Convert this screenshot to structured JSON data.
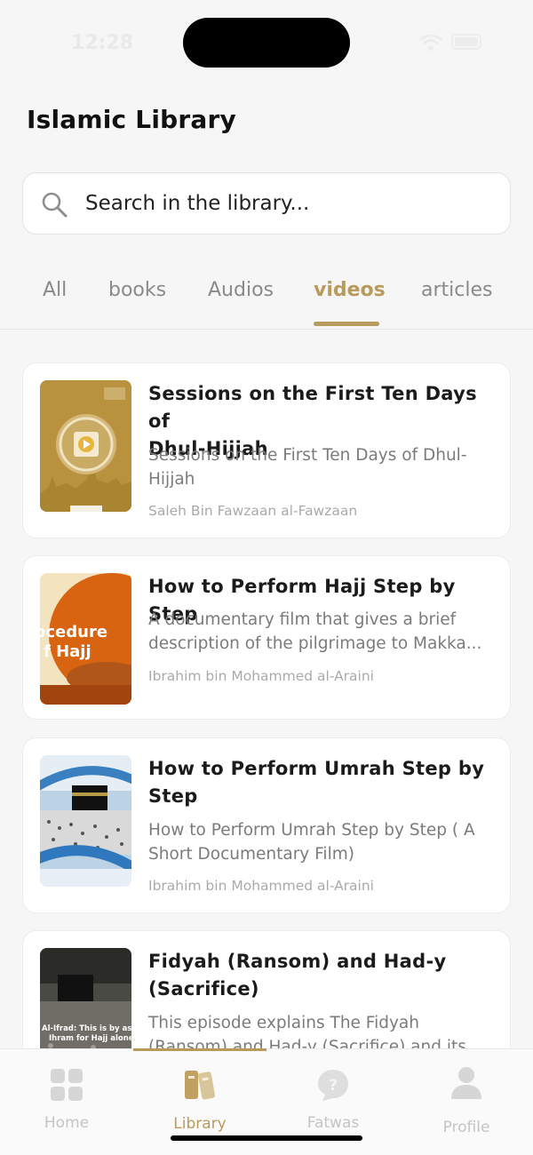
{
  "status": {
    "time": "12:28"
  },
  "header": {
    "title": "Islamic Library"
  },
  "search": {
    "placeholder": "Search in the library..."
  },
  "tabs": [
    {
      "label": "All"
    },
    {
      "label": "books"
    },
    {
      "label": "Audios"
    },
    {
      "label": "videos",
      "active": true
    },
    {
      "label": "articles"
    }
  ],
  "items": [
    {
      "title_line1": "Sessions on the First Ten Days of",
      "title_line2": "Dhul-Hijjah",
      "desc_line1": "Sessions on the First Ten Days of Dhul-",
      "desc_line2": "Hijjah",
      "author": "Saleh Bin Fawzaan al-Fawzaan",
      "thumb_text": "hajjumrah.com"
    },
    {
      "title_line1": "How to Perform Hajj Step by Step",
      "desc_line1": "A documentary film that gives a brief",
      "desc_line2": "description of the pilgrimage to Makka...",
      "author": "Ibrahim bin Mohammed al-Araini",
      "thumb_line1": "ocedure",
      "thumb_line2": "f Hajj"
    },
    {
      "title_line1": "How to Perform Umrah Step by",
      "title_line2": "Step",
      "desc_line1": "How to Perform Umrah Step by Step ( A",
      "desc_line2": "Short Documentary Film)",
      "author": "Ibrahim bin Mohammed al-Araini"
    },
    {
      "title_line1": "Fidyah (Ransom) and Had-y",
      "title_line2": "(Sacrifice)",
      "desc_line1": "This episode explains The Fidyah",
      "desc_line2": "(Ransom) and Had-y (Sacrifice) and its r...",
      "thumb_line1": "Al-Ifrad: This is by assumin",
      "thumb_line2": "Ihram for Hajj alone."
    }
  ],
  "nav": [
    {
      "label": "Home"
    },
    {
      "label": "Library",
      "active": true
    },
    {
      "label": "Fatwas"
    },
    {
      "label": "Profile"
    }
  ],
  "colors": {
    "accent": "#b99a5d",
    "background": "#f6f6f6",
    "card": "#ffffff"
  }
}
